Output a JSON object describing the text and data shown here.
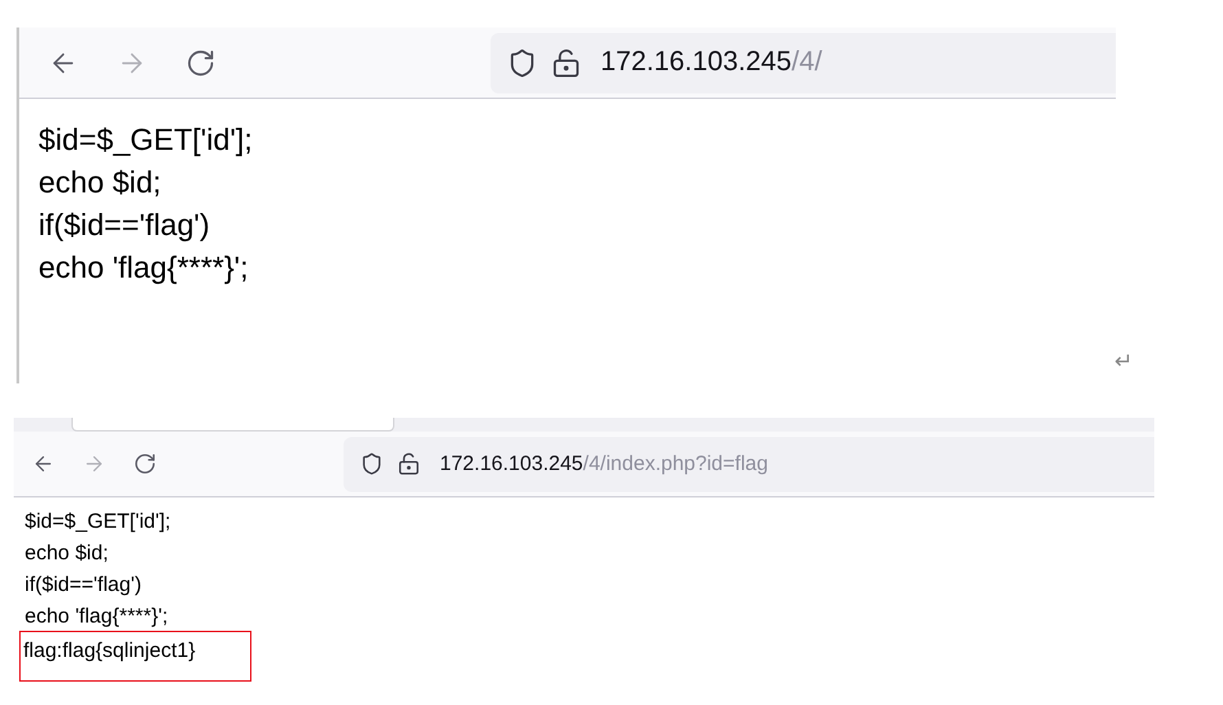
{
  "browsers": [
    {
      "has_tab_strip": false,
      "forward_disabled": true,
      "url_host": "172.16.103.245",
      "url_path": "/4/",
      "lines": [
        {
          "text": "$id=$_GET['id'];",
          "highlighted": false
        },
        {
          "text": "echo $id;",
          "highlighted": false
        },
        {
          "text": "if($id=='flag')",
          "highlighted": false
        },
        {
          "text": "echo 'flag{****}';",
          "highlighted": false
        }
      ]
    },
    {
      "has_tab_strip": true,
      "forward_disabled": true,
      "url_host": "172.16.103.245",
      "url_path": "/4/index.php?id=flag",
      "lines": [
        {
          "text": "$id=$_GET['id'];",
          "highlighted": false
        },
        {
          "text": "echo $id;",
          "highlighted": false
        },
        {
          "text": "if($id=='flag')",
          "highlighted": false
        },
        {
          "text": "echo 'flag{****}';",
          "highlighted": false
        },
        {
          "text": "flag:flag{sqlinject1}",
          "highlighted": true
        }
      ]
    }
  ],
  "return_mark": "↵"
}
